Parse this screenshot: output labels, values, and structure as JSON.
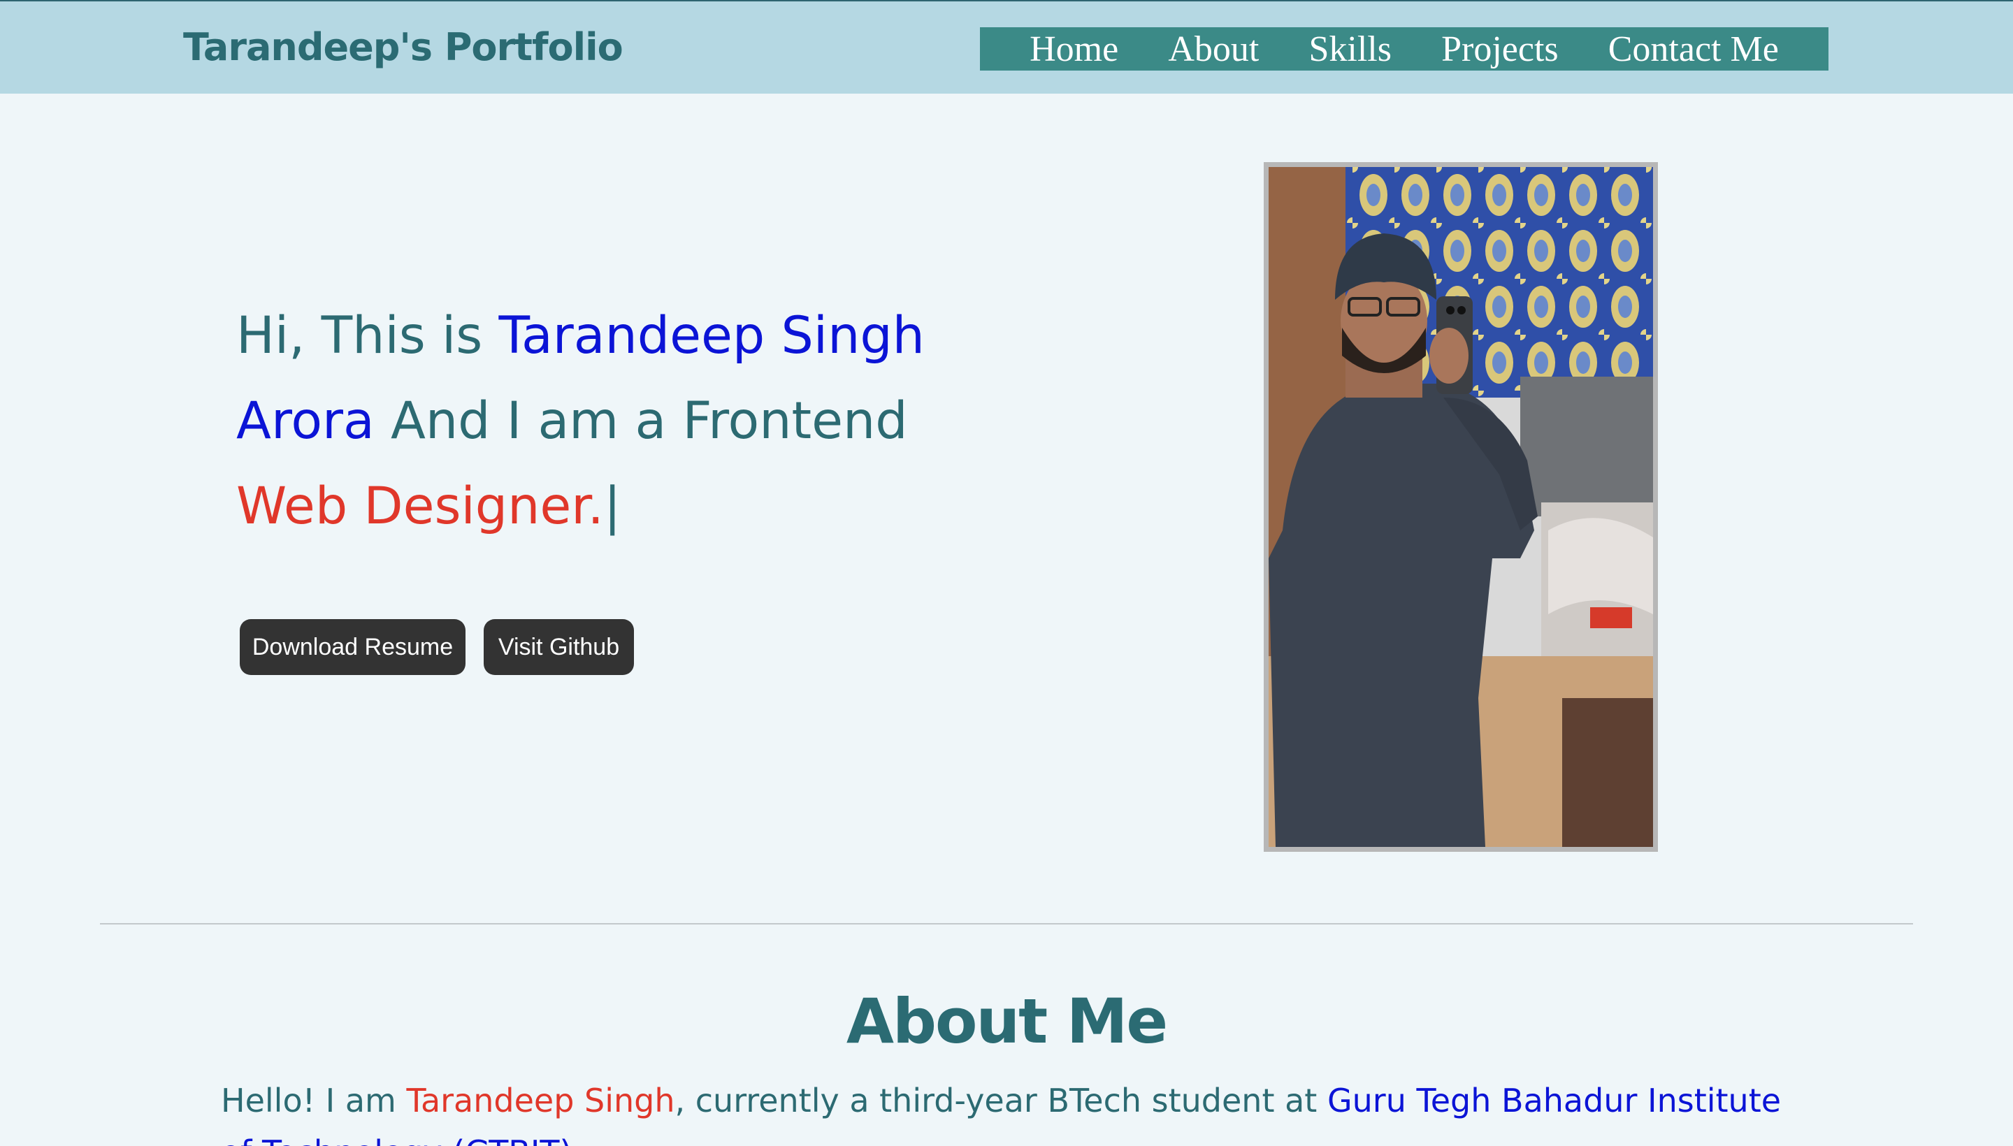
{
  "header": {
    "brand": "Tarandeep's Portfolio",
    "nav": [
      "Home",
      "About",
      "Skills",
      "Projects",
      "Contact Me"
    ]
  },
  "hero": {
    "intro": "Hi, This is ",
    "name": "Tarandeep Singh Arora",
    "middle": " And I am a Frontend ",
    "role": "Web Designer.",
    "cursor": "|",
    "buttons": {
      "resume": "Download Resume",
      "github": "Visit Github"
    },
    "photo_alt": "Tarandeep Singh Arora mirror selfie"
  },
  "about": {
    "title": "About Me",
    "text_start": "Hello! I am ",
    "name": "Tarandeep Singh",
    "text_mid": ", currently a third-year BTech student at ",
    "institute": "Guru Tegh Bahadur Institute of Technology (GTBIT)"
  },
  "colors": {
    "header_bg": "#b5d8e3",
    "nav_bg": "#3b8a87",
    "brand": "#2b6b73",
    "name_blue": "#0b14d6",
    "role_red": "#e0372a",
    "button_bg": "#333333",
    "page_bg": "#eff6f9"
  }
}
